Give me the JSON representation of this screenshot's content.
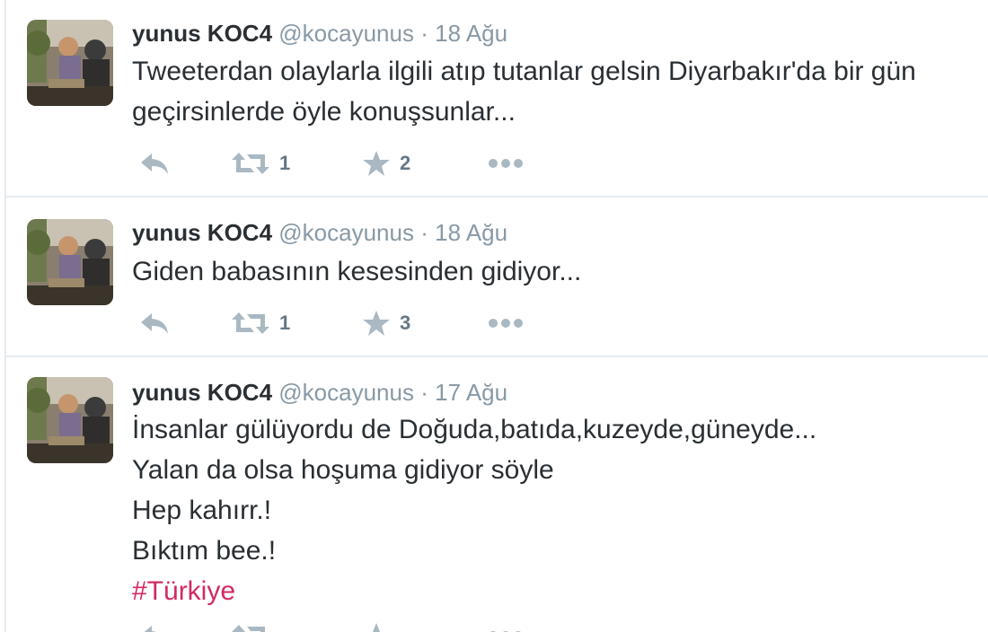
{
  "colors": {
    "text": "#292f33",
    "meta": "#8899a6",
    "hashtag": "#d32a62",
    "icon": "#aab8c2",
    "divider": "#e6ecf0"
  },
  "icons": {
    "reply": "reply-icon",
    "retweet": "retweet-icon",
    "favorite": "star-icon",
    "more": "more-icon"
  },
  "tweets": [
    {
      "fullname": "yunus KOC4",
      "handle": "@kocayunus",
      "separator": "·",
      "time": "18 Ağu",
      "lines": [
        "Tweeterdan olaylarla ilgili atıp tutanlar gelsin Diyarbakır'da bir gün",
        "geçirsinlerde öyle konuşsunlar..."
      ],
      "retweets": "1",
      "favorites": "2"
    },
    {
      "fullname": "yunus KOC4",
      "handle": "@kocayunus",
      "separator": "·",
      "time": "18 Ağu",
      "lines": [
        "Giden babasının kesesinden gidiyor..."
      ],
      "retweets": "1",
      "favorites": "3"
    },
    {
      "fullname": "yunus KOC4",
      "handle": "@kocayunus",
      "separator": "·",
      "time": "17 Ağu",
      "lines": [
        "İnsanlar gülüyordu de Doğuda,batıda,kuzeyde,güneyde...",
        "Yalan da olsa hoşuma gidiyor söyle",
        "Hep kahırr.!",
        "Bıktım bee.!"
      ],
      "hashtag": "#Türkiye"
    }
  ]
}
